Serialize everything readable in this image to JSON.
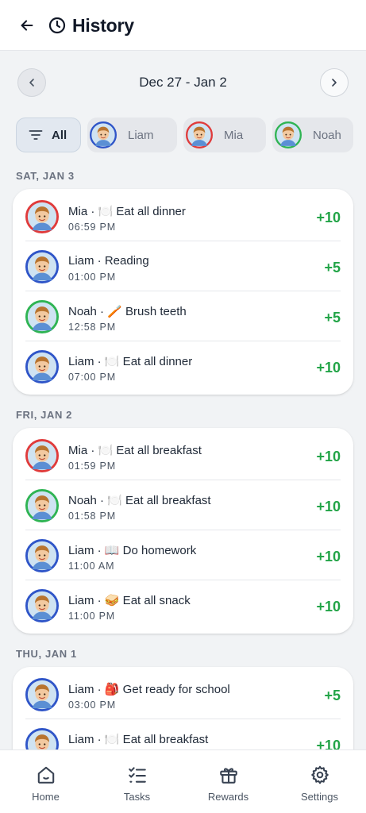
{
  "header": {
    "title": "History"
  },
  "week": {
    "label": "Dec 27 - Jan 2"
  },
  "filters": [
    {
      "label": "All",
      "selected": true
    },
    {
      "label": "Liam",
      "ring": "#2f55c8"
    },
    {
      "label": "Mia",
      "ring": "#e03b3b"
    },
    {
      "label": "Noah",
      "ring": "#2fb453"
    }
  ],
  "colors": {
    "liam": "#2f55c8",
    "mia": "#e03b3b",
    "noah": "#2fb453",
    "points": "#22a447"
  },
  "sections": [
    {
      "label": "SAT, JAN 3",
      "entries": [
        {
          "who": "mia",
          "name": "Mia · 🍽️ Eat all dinner",
          "time": "06:59 PM",
          "points": "+10"
        },
        {
          "who": "liam",
          "name": "Liam · Reading",
          "time": "01:00 PM",
          "points": "+5"
        },
        {
          "who": "noah",
          "name": "Noah · 🪥 Brush teeth",
          "time": "12:58 PM",
          "points": "+5"
        },
        {
          "who": "liam",
          "name": "Liam · 🍽️ Eat all dinner",
          "time": "07:00 PM",
          "points": "+10"
        }
      ]
    },
    {
      "label": "FRI, JAN 2",
      "entries": [
        {
          "who": "mia",
          "name": "Mia · 🍽️ Eat all breakfast",
          "time": "01:59 PM",
          "points": "+10"
        },
        {
          "who": "noah",
          "name": "Noah · 🍽️ Eat all breakfast",
          "time": "01:58 PM",
          "points": "+10"
        },
        {
          "who": "liam",
          "name": "Liam · 📖 Do homework",
          "time": "11:00 AM",
          "points": "+10"
        },
        {
          "who": "liam",
          "name": "Liam · 🥪 Eat all snack",
          "time": "11:00 PM",
          "points": "+10"
        }
      ]
    },
    {
      "label": "THU, JAN 1",
      "entries": [
        {
          "who": "liam",
          "name": "Liam · 🎒 Get ready for school",
          "time": "03:00 PM",
          "points": "+5"
        },
        {
          "who": "liam",
          "name": "Liam · 🍽️ Eat all breakfast",
          "time": "",
          "points": "+10"
        }
      ]
    }
  ],
  "nav": [
    {
      "label": "Home",
      "icon": "home-icon"
    },
    {
      "label": "Tasks",
      "icon": "tasks-icon"
    },
    {
      "label": "Rewards",
      "icon": "gift-icon"
    },
    {
      "label": "Settings",
      "icon": "gear-icon"
    }
  ]
}
